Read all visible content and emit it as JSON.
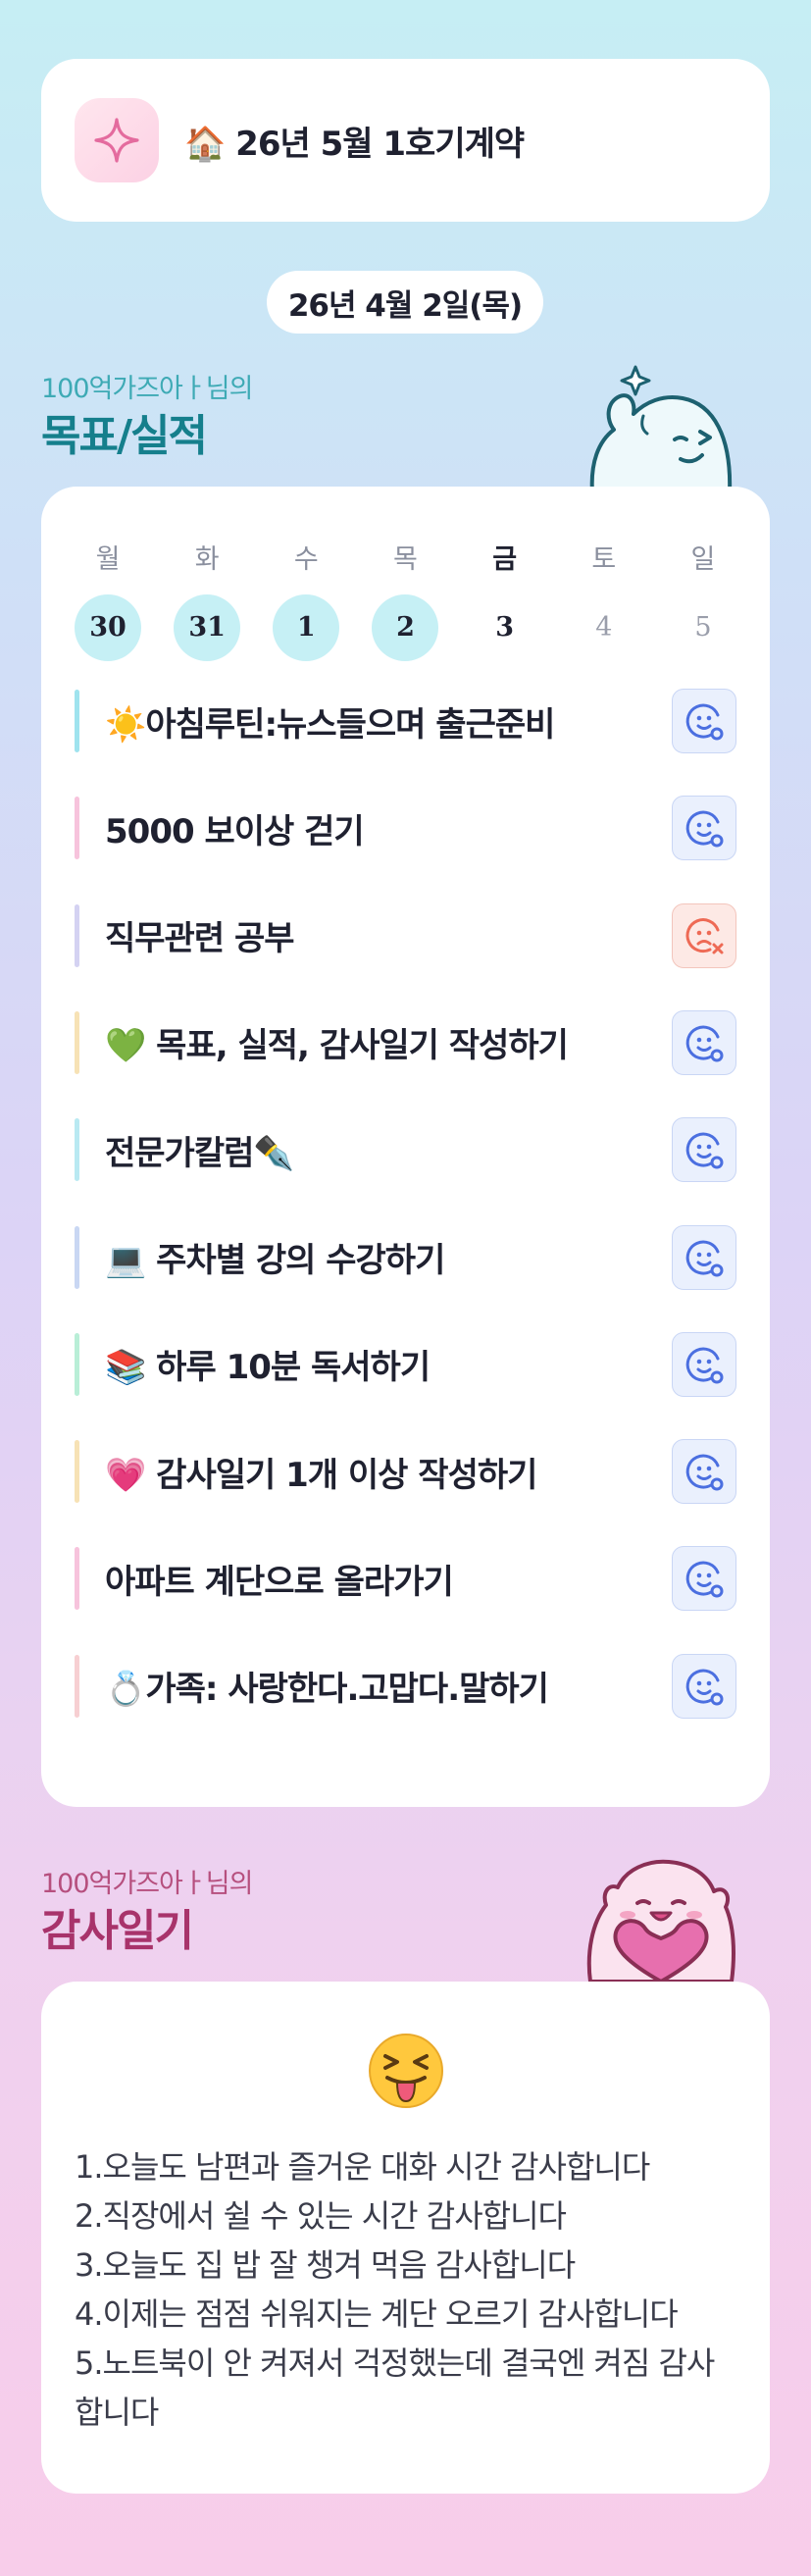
{
  "goal": {
    "icon": "sparkle-icon",
    "text": "🏠 26년 5월 1호기계약"
  },
  "date": "26년 4월 2일(목)",
  "goals_section": {
    "subtitle": "100억가즈아ㅏ님의",
    "title": "목표/실적"
  },
  "calendar": {
    "days": [
      "월",
      "화",
      "수",
      "목",
      "금",
      "토",
      "일"
    ],
    "dates": [
      "30",
      "31",
      "1",
      "2",
      "3",
      "4",
      "5"
    ],
    "completed_count": 4,
    "today_index": 4
  },
  "tasks": [
    {
      "label": "☀️아침루틴:뉴스들으며 출근준비",
      "status": "achieved",
      "bar_color": "#9fe3ee"
    },
    {
      "label": "5000  보이상 걷기",
      "status": "achieved",
      "bar_color": "#f7c3dc"
    },
    {
      "label": "직무관련 공부",
      "status": "missed",
      "bar_color": "#d4d2f2"
    },
    {
      "label": "💚 목표, 실적, 감사일기 작성하기",
      "status": "achieved",
      "bar_color": "#f7e2b5"
    },
    {
      "label": "전문가칼럼✒️",
      "status": "achieved",
      "bar_color": "#b9e9f2"
    },
    {
      "label": "💻 주차별 강의 수강하기",
      "status": "achieved",
      "bar_color": "#c9d7f3"
    },
    {
      "label": "📚 하루 10분 독서하기",
      "status": "achieved",
      "bar_color": "#b9eed7"
    },
    {
      "label": "💗 감사일기 1개 이상 작성하기",
      "status": "achieved",
      "bar_color": "#f7e2b5"
    },
    {
      "label": "아파트 계단으로 올라가기",
      "status": "achieved",
      "bar_color": "#f7c3dc"
    },
    {
      "label": "💍가족: 사랑한다.고맙다.말하기",
      "status": "achieved",
      "bar_color": "#f7cfd2"
    }
  ],
  "diary_section": {
    "subtitle": "100억가즈아ㅏ님의",
    "title": "감사일기"
  },
  "diary": {
    "mood_icon": "tongue-out-emoji-icon",
    "lines": [
      "1.오늘도 남편과 즐거운 대화 시간 감사합니다",
      "2.직장에서 쉴 수 있는 시간 감사합니다",
      "3.오늘도 집 밥 잘 챙겨 먹음 감사합니다",
      "4.이제는 점점 쉬워지는 계단 오르기 감사합니다",
      "5.노트북이 안 켜져서 걱정했는데 결국엔 켜짐 감사",
      "합니다"
    ]
  },
  "colors": {
    "goals_subtitle": "#3eaab5",
    "goals_title": "#157f8c",
    "diary_subtitle": "#b64f7e",
    "diary_title": "#a8336b",
    "achieved_icon": "#4b6fe0",
    "missed_icon": "#ee6a55",
    "calendar_done": "#c6f0f5"
  }
}
